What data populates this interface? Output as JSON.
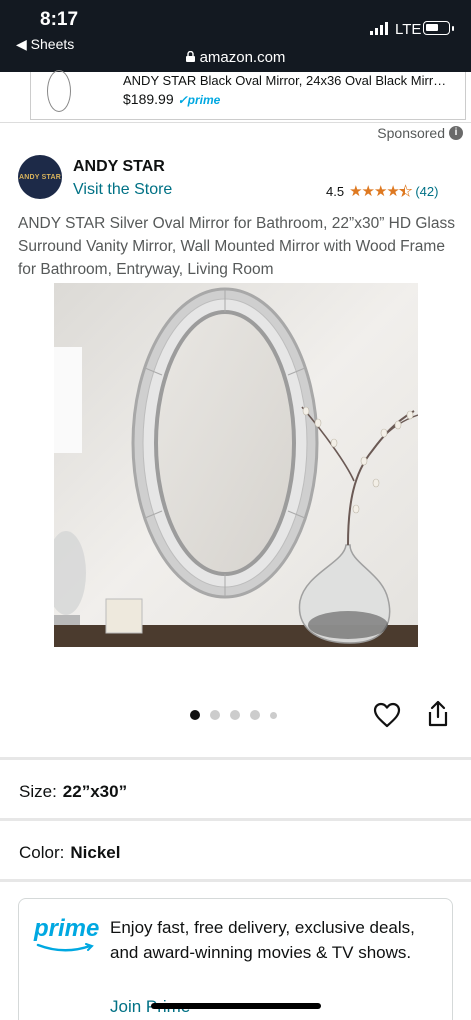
{
  "status_bar": {
    "time": "8:17",
    "back_label": "◀ Sheets",
    "network": "LTE",
    "url": "amazon.com"
  },
  "sticky_product": {
    "title": "ANDY STAR Black Oval Mirror, 24x36 Oval Black Mirr…",
    "price": "$189.99",
    "prime_badge": "✓prime"
  },
  "sponsored": {
    "label": "Sponsored"
  },
  "brand": {
    "logo_text": "ANDY STAR",
    "name": "ANDY STAR",
    "visit_store": "Visit the Store"
  },
  "rating": {
    "value": "4.5",
    "count": "(42)",
    "star_color": "#de7921"
  },
  "product": {
    "title": "ANDY STAR Silver Oval Mirror for Bathroom, 22”x30” HD Glass Surround Vanity Mirror, Wall Mounted Mirror with Wood Frame for Bathroom, Entryway, Living Room"
  },
  "image_carousel": {
    "total_dots": 5,
    "active_index": 0
  },
  "options": {
    "size_label": "Size:",
    "size_value": "22”x30”",
    "color_label": "Color:",
    "color_value": "Nickel"
  },
  "prime_promo": {
    "logo": "prime",
    "text": "Enjoy fast, free delivery, exclusive deals, and award-winning movies & TV shows.",
    "link": "Join Prime"
  },
  "colors": {
    "header_bg": "#131921",
    "link": "#007185",
    "prime_blue": "#00a8e1"
  }
}
